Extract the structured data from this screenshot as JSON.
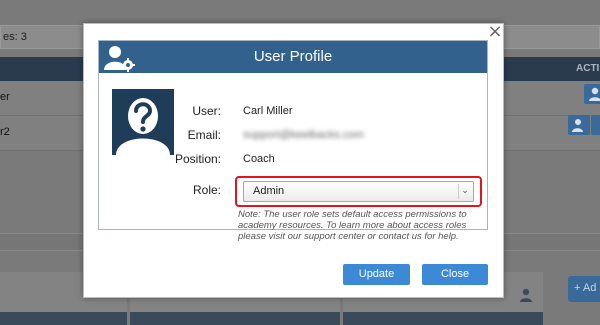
{
  "background": {
    "top_field_text": "es: 3",
    "header_action_label": "ACTI",
    "rows": [
      {
        "label": "er"
      },
      {
        "label": "r2"
      }
    ],
    "add_button_label": "+ Ad"
  },
  "modal": {
    "close_glyph": "×",
    "title": "User Profile",
    "fields": {
      "user_label": "User:",
      "user_value": "Carl Miller",
      "email_label": "Email:",
      "email_value": "support@keelbacks.com",
      "position_label": "Position:",
      "position_value": "Coach",
      "role_label": "Role:",
      "role_value": "Admin"
    },
    "note": "Note: The user role sets default access permissions to academy resources. To learn more about access roles please visit our support center or contact us for help.",
    "buttons": {
      "update": "Update",
      "close": "Close"
    }
  },
  "colors": {
    "header_blue": "#33618e",
    "button_blue": "#3c8ad6",
    "highlight_red": "#e3141b",
    "avatar_navy": "#1f3d58"
  },
  "icons": [
    "user-settings-icon",
    "person-placeholder-icon",
    "chevron-down-icon",
    "close-icon",
    "user-icon"
  ]
}
